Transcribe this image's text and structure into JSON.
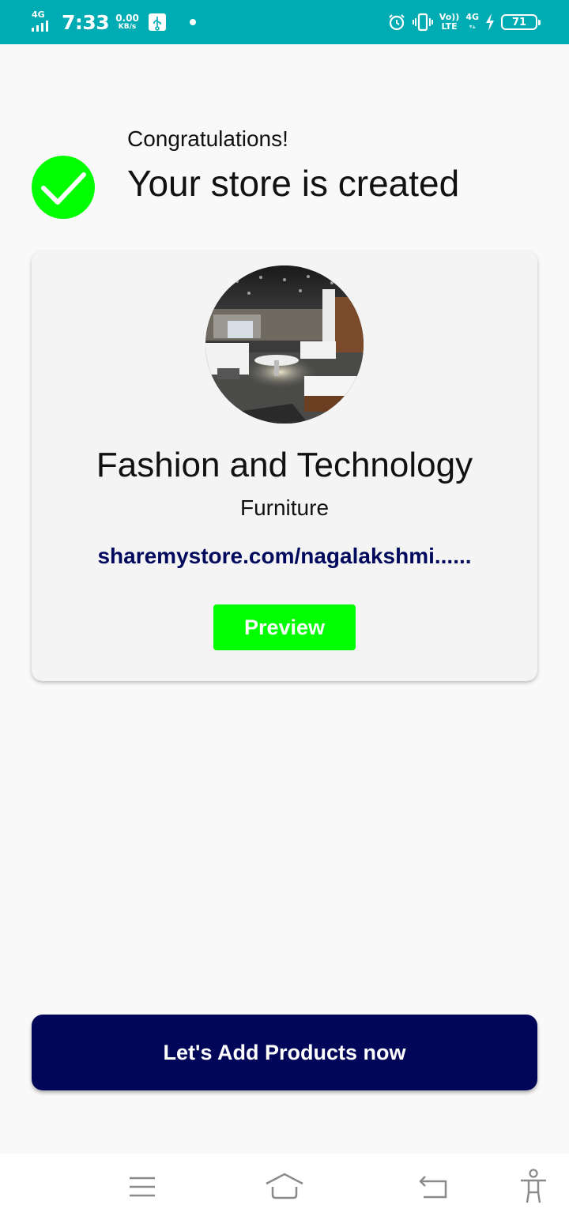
{
  "status_bar": {
    "network": "4G",
    "time": "7:33",
    "speed_value": "0.00",
    "speed_unit": "KB/s",
    "volte_top": "Vo))",
    "volte_bottom": "LTE",
    "network_right": "4G",
    "battery": "71",
    "icons": [
      "signal-icon",
      "usb-icon",
      "alarm-icon",
      "vibrate-icon",
      "charging-icon",
      "battery-icon"
    ]
  },
  "header": {
    "congrats": "Congratulations!",
    "title": "Your store is created"
  },
  "store": {
    "name": "Fashion and Technology",
    "category": "Furniture",
    "url": "sharemystore.com/nagalakshmi......",
    "preview_label": "Preview"
  },
  "cta": {
    "label": "Let's Add Products now"
  },
  "nav": {
    "icons": [
      "menu-icon",
      "home-icon",
      "back-icon",
      "accessibility-icon"
    ]
  },
  "colors": {
    "status_bar": "#00acb3",
    "success_green": "#00ff00",
    "navy": "#020659",
    "url_text": "#020a5e"
  }
}
